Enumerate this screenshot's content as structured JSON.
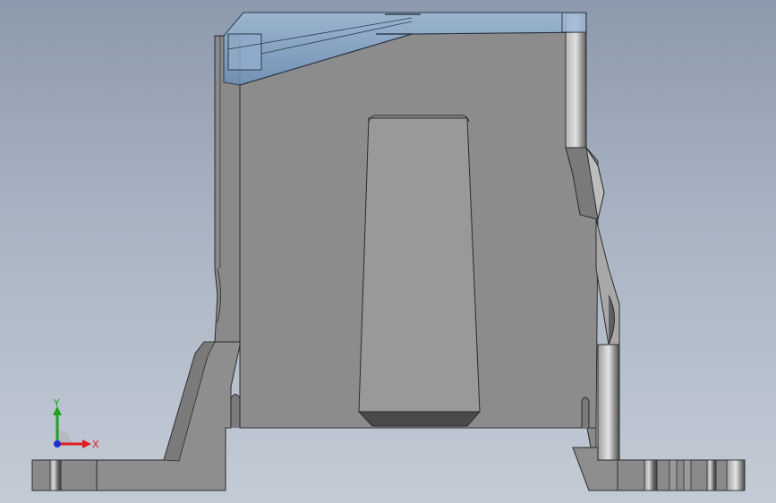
{
  "viewport": {
    "background_top": "#8d9aad",
    "background_bottom": "#c3cbd6"
  },
  "model": {
    "body_color": "#8c8c8c",
    "edge_color": "#2b2b2b",
    "dark_face_color": "#575757",
    "shade_color": "#6f6f6f",
    "transparent_part_color": "#7f9fc1"
  },
  "triad": {
    "x_label": "X",
    "y_label": "Y",
    "x_color": "#e02020",
    "y_color": "#20a020",
    "z_color": "#2030d0"
  }
}
